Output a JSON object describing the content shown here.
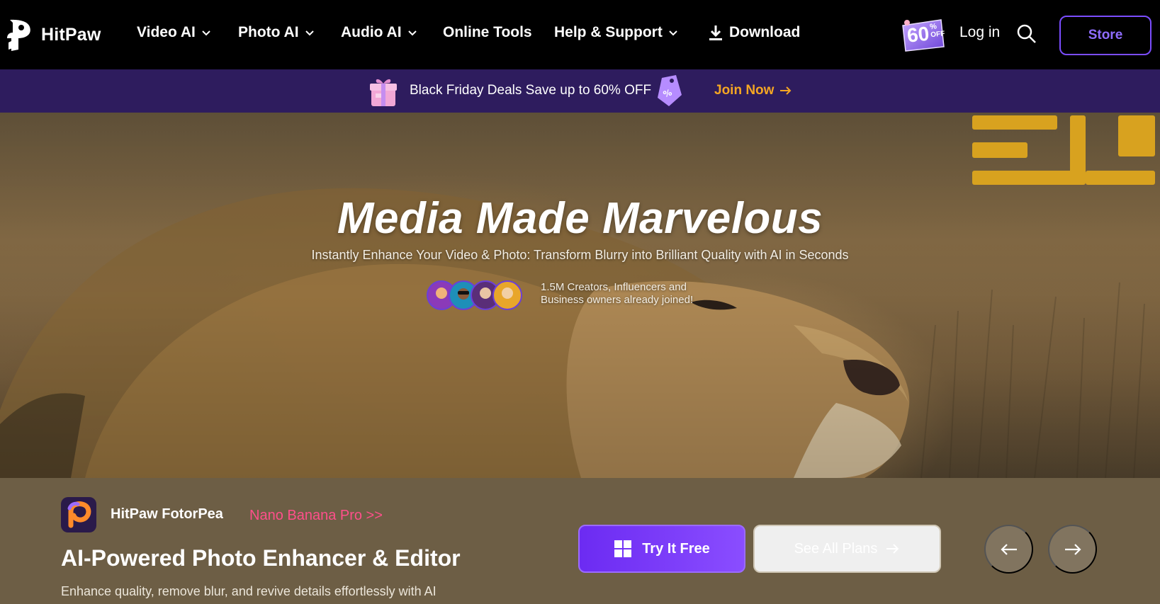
{
  "brand": {
    "name": "HitPaw"
  },
  "nav": {
    "items": [
      {
        "label": "Video AI",
        "dropdown": true
      },
      {
        "label": "Photo AI",
        "dropdown": true
      },
      {
        "label": "Audio AI",
        "dropdown": true
      },
      {
        "label": "Online Tools",
        "dropdown": false
      },
      {
        "label": "Help & Support",
        "dropdown": true
      },
      {
        "label": "Download",
        "dropdown": false,
        "icon": "download-icon"
      }
    ],
    "discount_badge": {
      "value": "60",
      "unit": "%",
      "note": "OFF"
    },
    "login_label": "Log in",
    "search_icon": "search-icon",
    "store_label": "Store",
    "accent": "#7b4dff"
  },
  "promo": {
    "text": "Black Friday Deals Save up to 60% OFF",
    "cta": "Join Now",
    "cta_color": "#f5a623",
    "background": "#2e1c5e"
  },
  "hero": {
    "title": "Media Made Marvelous",
    "subtitle": "Instantly Enhance Your Video & Photo: Transform Blurry into Brilliant Quality with AI in Seconds",
    "social_proof": {
      "line1": "1.5M Creators, Influencers and",
      "line2": "Business owners already joined!",
      "avatar_count": 4
    }
  },
  "product": {
    "app_name": "HitPaw FotorPea",
    "tag": "Nano Banana Pro >>",
    "tag_color": "#ff4f8b",
    "title": "AI-Powered Photo Enhancer & Editor",
    "description": "Enhance quality, remove blur, and revive details effortlessly with AI",
    "primary_cta": "Try It Free",
    "secondary_cta": "See All Plans",
    "prev_icon": "arrow-left-icon",
    "next_icon": "arrow-right-icon"
  }
}
